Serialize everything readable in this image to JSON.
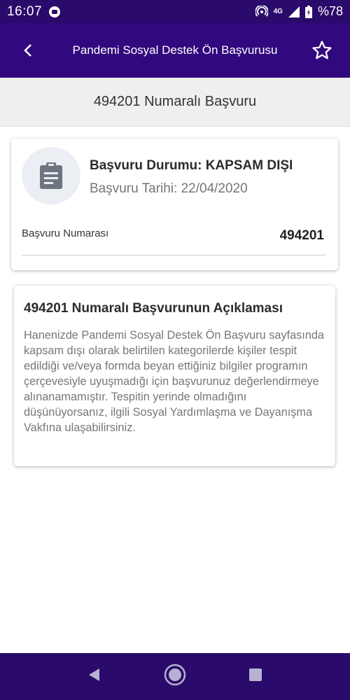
{
  "status_bar": {
    "time": "16:07",
    "network": "4G",
    "battery": "%78"
  },
  "app_bar": {
    "title": "Pandemi Sosyal Destek Ön Başvurusu",
    "back_icon": "back-arrow-icon",
    "favorite_icon": "star-outline-icon"
  },
  "subheader": {
    "title": "494201 Numaralı Başvuru"
  },
  "status_card": {
    "icon": "clipboard-icon",
    "status": "Başvuru Durumu: KAPSAM DIŞI",
    "date": "Başvuru Tarihi: 22/04/2020",
    "application_number_label": "Başvuru Numarası",
    "application_number_value": "494201"
  },
  "description_card": {
    "title": "494201 Numaralı Başvurunun Açıklaması",
    "body": "Hanenizde Pandemi Sosyal Destek Ön Başvuru sayfasında kapsam dışı olarak belirtilen kategorilerde kişiler tespit edildiği ve/veya formda beyan ettiğiniz bilgiler programın çerçevesiyle uyuşmadığı için başvurunuz değerlendirmeye alınanamamıştır. Tespitin yerinde olmadığını düşünüyorsanız, ilgili Sosyal Yardımlaşma ve Dayanışma Vakfına ulaşabilirsiniz."
  },
  "nav_bar": {
    "back": "nav-back-icon",
    "home": "nav-home-icon",
    "recents": "nav-recents-icon"
  },
  "colors": {
    "status_bar": "#2a0a6a",
    "app_bar": "#31087d",
    "subheader": "#efefef"
  }
}
